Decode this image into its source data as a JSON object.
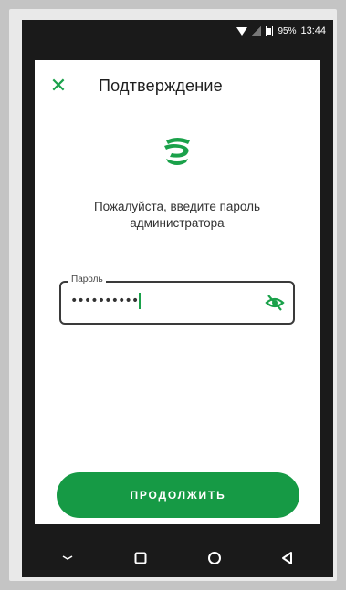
{
  "status_bar": {
    "battery": "95%",
    "time": "13:44"
  },
  "header": {
    "close_icon": "close-icon",
    "title": "Подтверждение"
  },
  "logo_icon": "sber-logo-icon",
  "prompt": "Пожалуйста, введите пароль администратора",
  "password_field": {
    "label": "Пароль",
    "value": "••••••••••",
    "toggle_icon": "eye-off-icon"
  },
  "continue_button": {
    "label": "ПРОДОЛЖИТЬ"
  },
  "nav": {
    "items": [
      "chevron-down-icon",
      "recent-apps-icon",
      "home-icon",
      "back-icon"
    ]
  },
  "colors": {
    "accent": "#169a45",
    "accent_light": "#1aa14a"
  }
}
